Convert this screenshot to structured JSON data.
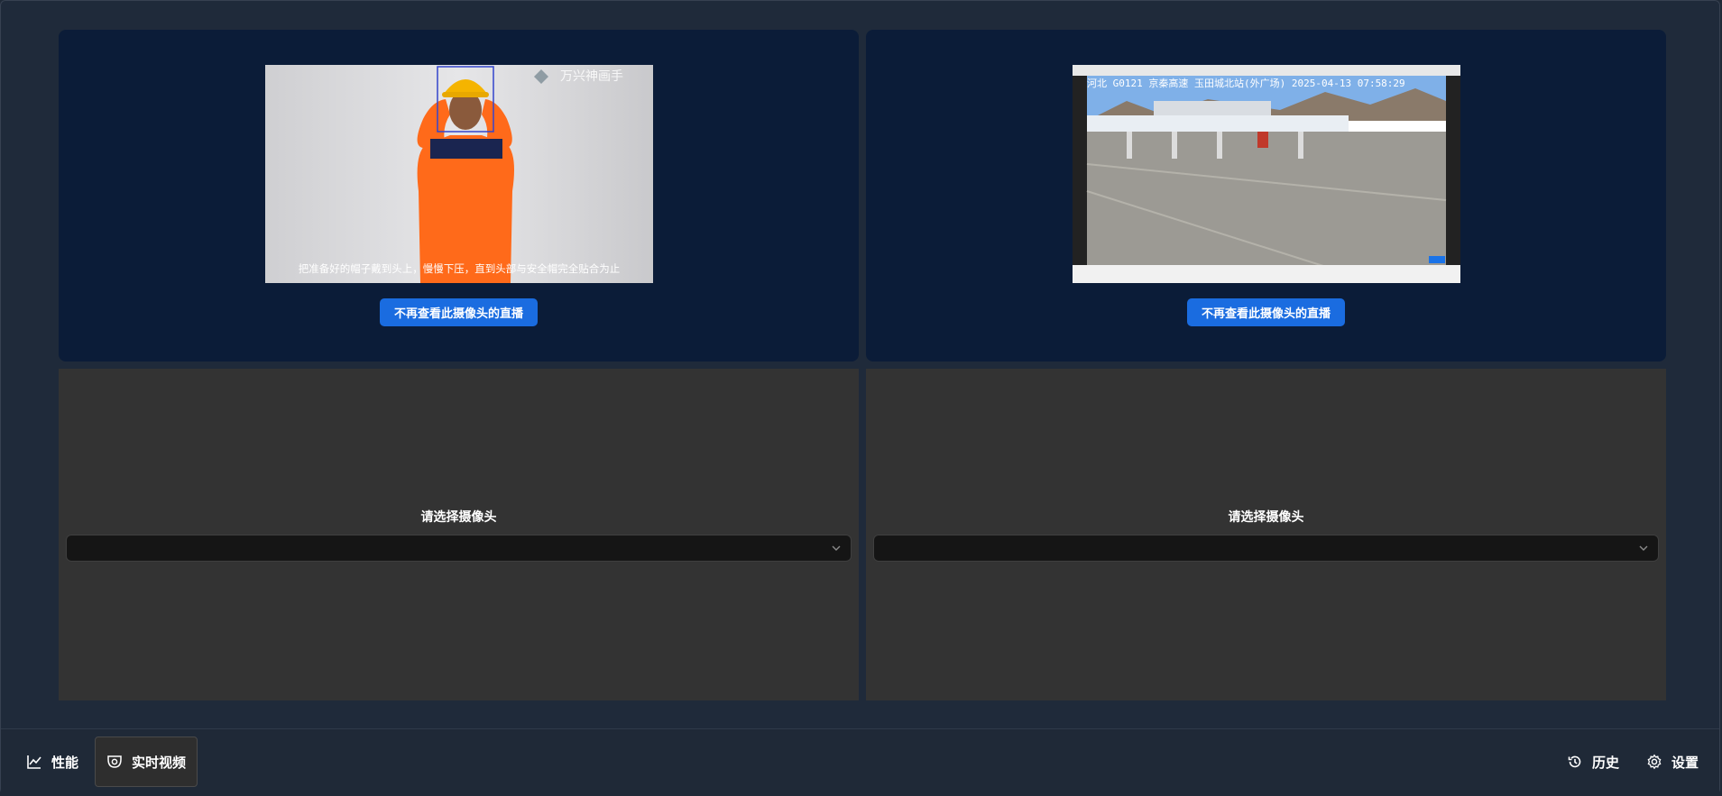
{
  "cameras": {
    "live": [
      {
        "stop_label": "不再查看此摄像头的直播",
        "overlay": {
          "watermark": "万兴神画手",
          "subtitle": "把准备好的帽子戴到头上，慢慢下压，直到头部与安全帽完全贴合为止"
        }
      },
      {
        "stop_label": "不再查看此摄像头的直播",
        "overlay": {
          "banner": "河北 G0121 京秦高速  玉田城北站(外广场)  2025-04-13 07:58:29"
        }
      }
    ],
    "empty": [
      {
        "label": "请选择摄像头",
        "selected": ""
      },
      {
        "label": "请选择摄像头",
        "selected": ""
      }
    ]
  },
  "bottom_nav": {
    "performance": "性能",
    "live_video": "实时视频",
    "history": "历史",
    "settings": "设置"
  },
  "colors": {
    "live_panel": "#0b1c38",
    "empty_panel": "#333333",
    "accent": "#1a6ce0"
  }
}
